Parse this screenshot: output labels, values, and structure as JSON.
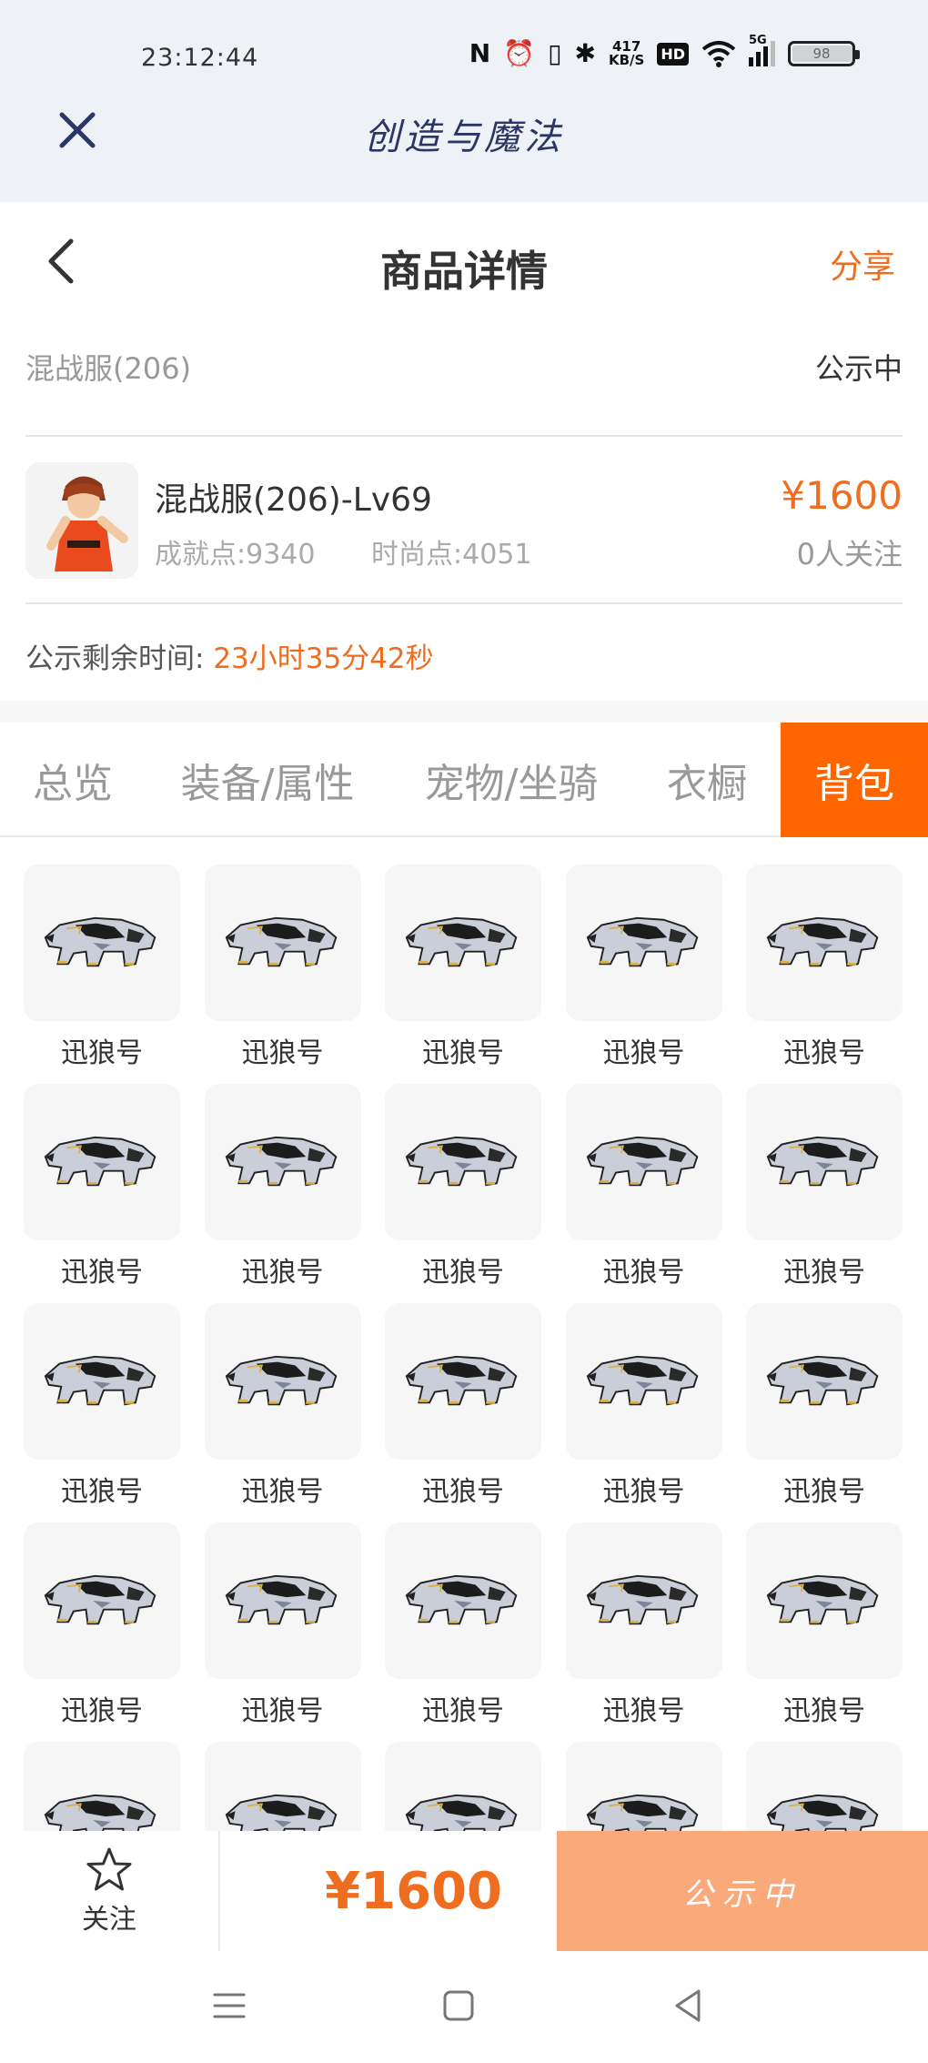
{
  "status_bar": {
    "time": "23:12:44",
    "net_speed_value": "417",
    "net_speed_unit": "KB/S",
    "hd_label": "HD",
    "signal_label": "5G",
    "battery_level": "98"
  },
  "app_header": {
    "title": "创造与魔法"
  },
  "nav": {
    "title": "商品详情",
    "share_label": "分享"
  },
  "server": {
    "name": "混战服(206)",
    "status": "公示中"
  },
  "item": {
    "title": "混战服(206)-Lv69",
    "achievement": "成就点:9340",
    "fashion": "时尚点:4051",
    "price": "¥1600",
    "followers": "0人关注"
  },
  "countdown": {
    "label": "公示剩余时间:",
    "value": "23小时35分42秒"
  },
  "tabs": [
    {
      "label": "总览"
    },
    {
      "label": "装备/属性"
    },
    {
      "label": "宠物/坐骑"
    },
    {
      "label": "衣橱"
    },
    {
      "label": "背包"
    }
  ],
  "active_tab": "背包",
  "bag_items": [
    "迅狼号",
    "迅狼号",
    "迅狼号",
    "迅狼号",
    "迅狼号",
    "迅狼号",
    "迅狼号",
    "迅狼号",
    "迅狼号",
    "迅狼号",
    "迅狼号",
    "迅狼号",
    "迅狼号",
    "迅狼号",
    "迅狼号",
    "迅狼号",
    "迅狼号",
    "迅狼号",
    "迅狼号",
    "迅狼号",
    "",
    "",
    "",
    "",
    ""
  ],
  "bottom_bar": {
    "follow_label": "关注",
    "price": "¥1600",
    "action_label": "公示中"
  },
  "colors": {
    "accent": "#ee6d1f",
    "tab_active": "#ff6600",
    "action_button": "#f9a97a"
  }
}
